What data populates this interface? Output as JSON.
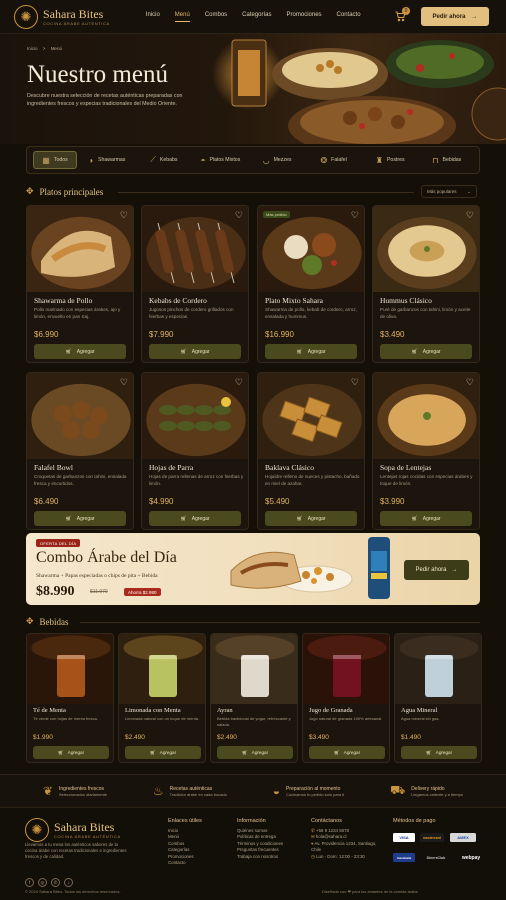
{
  "nav": {
    "brand": "Sahara Bites",
    "tagline": "COCINA ÁRABE AUTÉNTICA",
    "links": [
      "Inicio",
      "Menú",
      "Combos",
      "Categorías",
      "Promociones",
      "Contacto"
    ],
    "active": "Menú",
    "cart_count": "0",
    "order_label": "Pedir ahora"
  },
  "hero": {
    "breadcrumb_home": "Inicio",
    "breadcrumb_sep": ">",
    "breadcrumb_current": "Menú",
    "title": "Nuestro menú",
    "description": "Descubre nuestra selección de recetas auténticas preparadas con ingredientes frescos y especias tradicionales del Medio Oriente."
  },
  "categories": [
    {
      "label": "Todos",
      "icon": "grid-icon"
    },
    {
      "label": "Shawarmas",
      "icon": "wrap-icon"
    },
    {
      "label": "Kebabs",
      "icon": "skewer-icon"
    },
    {
      "label": "Platos Mixtos",
      "icon": "platter-icon"
    },
    {
      "label": "Mezzes",
      "icon": "bowl-icon"
    },
    {
      "label": "Falafel",
      "icon": "falafel-icon"
    },
    {
      "label": "Postres",
      "icon": "dessert-icon"
    },
    {
      "label": "Bebidas",
      "icon": "drink-icon"
    }
  ],
  "mains": {
    "title": "Platos principales",
    "sort_label": "Más populares",
    "add_label": "Agregar",
    "items": [
      {
        "name": "Shawarma de Pollo",
        "desc": "Pollo marinado con especias árabes, ajo y limón, envuelto en pan Saj.",
        "price": "$6.990",
        "badge": ""
      },
      {
        "name": "Kebabs de Cordero",
        "desc": "Jugosos pinchos de cordero grillados con hierbas y especias.",
        "price": "$7.990",
        "badge": ""
      },
      {
        "name": "Plato Mixto Sahara",
        "desc": "Shawarma de pollo, kebab de cordero, arroz, ensalada y hummus.",
        "price": "$16.990",
        "badge": "Más pedido"
      },
      {
        "name": "Hummus Clásico",
        "desc": "Puré de garbanzos con tahini, limón y aceite de oliva.",
        "price": "$3.490",
        "badge": ""
      },
      {
        "name": "Falafel Bowl",
        "desc": "Croquetas de garbanzos con tahini, ensalada fresca y encurtidos.",
        "price": "$6.490",
        "badge": ""
      },
      {
        "name": "Hojas de Parra",
        "desc": "Hojas de parra rellenas de arroz con hierbas y limón.",
        "price": "$4.990",
        "badge": ""
      },
      {
        "name": "Baklava Clásico",
        "desc": "Hojaldre relleno de nueces y pistacho, bañado en miel de azahar.",
        "price": "$5.490",
        "badge": ""
      },
      {
        "name": "Sopa de Lentejas",
        "desc": "Lentejas rojas cocidas con especias árabes y toque de limón.",
        "price": "$3.990",
        "badge": ""
      }
    ]
  },
  "promo": {
    "tag": "OFERTA DEL DÍA",
    "title": "Combo Árabe del Día",
    "subtitle": "Shawarma + Papas especiadas o chips de pita + Bebida",
    "price": "$8.990",
    "old_price": "$11.970",
    "saving": "Ahorra $2.980",
    "button": "Pedir ahora"
  },
  "drinks": {
    "title": "Bebidas",
    "add_label": "Agregar",
    "items": [
      {
        "name": "Té de Menta",
        "desc": "Té verde con hojas de menta fresca.",
        "price": "$1.990"
      },
      {
        "name": "Limonada con Menta",
        "desc": "Limonada natural con un toque de menta.",
        "price": "$2.490"
      },
      {
        "name": "Ayran",
        "desc": "Bebida tradicional de yogur, refrescante y salada.",
        "price": "$2.490"
      },
      {
        "name": "Jugo de Granada",
        "desc": "Jugo natural de granada 100% artesanal.",
        "price": "$3.490"
      },
      {
        "name": "Agua Mineral",
        "desc": "Agua mineral sin gas.",
        "price": "$1.490"
      }
    ]
  },
  "features": [
    {
      "title": "Ingredientes frescos",
      "sub": "Seleccionados diariamente",
      "icon": "leaf-icon"
    },
    {
      "title": "Recetas auténticas",
      "sub": "Tradición árabe en cada bocado",
      "icon": "lamp-icon"
    },
    {
      "title": "Preparación al momento",
      "sub": "Cocinamos tu pedido solo para ti",
      "icon": "pot-icon"
    },
    {
      "title": "Delivery rápido",
      "sub": "Llegamos caliente y a tiempo",
      "icon": "scooter-icon"
    }
  ],
  "footer": {
    "brand": "Sahara Bites",
    "tagline": "COCINA ÁRABE AUTÉNTICA",
    "about": "Llevamos a tu mesa los auténticos sabores de la cocina árabe con recetas tradicionales e ingredientes frescos y de calidad.",
    "links_title": "Enlaces útiles",
    "links": [
      "Inicio",
      "Menú",
      "Combos",
      "Categorías",
      "Promociones",
      "Contacto"
    ],
    "info_title": "Información",
    "info": [
      "Quiénes somos",
      "Políticas de entrega",
      "Términos y condiciones",
      "Preguntas frecuentes",
      "Trabaja con nosotros"
    ],
    "contact_title": "Contáctanos",
    "contact": [
      "+56 9 1234 5678",
      "hola@sahara.cl",
      "Av. Providencia 1234, Santiago, Chile",
      "Lun - Dom: 12:00 - 23:30"
    ],
    "pay_title": "Métodos de pago",
    "payments": [
      "VISA",
      "mastercard",
      "AMEX",
      "transbank",
      "DinersClub",
      "webpay"
    ],
    "copyright": "© 2024 Sahara Bites. Todos los derechos reservados.",
    "made": "Diseñado con ❤ para los amantes de la comida árabe."
  },
  "colors": {
    "accent": "#d8a24a",
    "button": "#4a4a1f",
    "background": "#141008"
  }
}
